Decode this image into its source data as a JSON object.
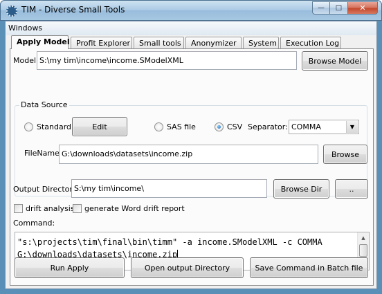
{
  "window": {
    "title": "TIM - Diverse Small Tools",
    "min_glyph": "—",
    "max_glyph": "□",
    "close_glyph": "✕"
  },
  "menu": {
    "windows_label": "Windows"
  },
  "tabs": [
    {
      "label": "Apply Model",
      "active": true
    },
    {
      "label": "Profit Explorer",
      "active": false
    },
    {
      "label": "Small tools",
      "active": false
    },
    {
      "label": "Anonymizer",
      "active": false
    },
    {
      "label": "System",
      "active": false
    },
    {
      "label": "Execution Log",
      "active": false
    }
  ],
  "model": {
    "label": "Model",
    "value": "S:\\my tim\\income\\income.SModelXML",
    "browse_label": "Browse Model"
  },
  "data_source": {
    "legend": "Data Source",
    "standard_label": "Standard",
    "edit_label": "Edit",
    "sas_label": "SAS file",
    "csv_label": "CSV",
    "selected": "CSV",
    "separator_label": "Separator:",
    "separator_value": "COMMA",
    "filename_label": "FileName",
    "filename_value": "G:\\downloads\\datasets\\income.zip",
    "browse_label": "Browse"
  },
  "output": {
    "label": "Output Directory",
    "value": "S:\\my tim\\income\\",
    "browse_dir_label": "Browse Dir",
    "dots_label": ".."
  },
  "options": {
    "drift_label": "drift analysis",
    "drift_checked": false,
    "word_label": "generate Word drift report",
    "word_checked": false
  },
  "command": {
    "label": "Command:",
    "line1": "\"s:\\projects\\tim\\final\\bin\\timm\" -a income.SModelXML -c COMMA",
    "line2": "G:\\downloads\\datasets\\income.zip"
  },
  "actions": {
    "run_label": "Run Apply",
    "open_output_label": "Open output Directory",
    "save_batch_label": "Save Command in Batch file"
  },
  "colors": {
    "title_bar": "#a9c9e4",
    "close_button": "#c4462b",
    "panel_bg": "#fbfbfb"
  }
}
